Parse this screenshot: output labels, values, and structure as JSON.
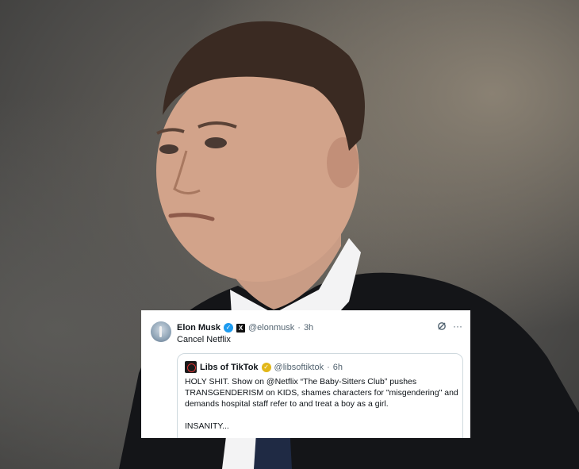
{
  "tweet": {
    "author_name": "Elon Musk",
    "handle": "@elonmusk",
    "separator": "·",
    "time": "3h",
    "text": "Cancel Netflix",
    "more_icon": "···"
  },
  "quoted_tweet": {
    "author_name": "Libs of TikTok",
    "handle": "@libsoftiktok",
    "separator": "·",
    "time": "6h",
    "body_line1": "HOLY SHIT. Show on @Netflix “The Baby-Sitters Club” pushes TRANSGENDERISM on KIDS, shames characters for \"misgendering\" and demands hospital staff refer to and treat a boy as a girl.",
    "body_line2": "INSANITY..."
  },
  "icons": {
    "verified_author": "blue-verified-check-icon",
    "x_affiliation": "x-logo-icon",
    "verified_quoted": "gold-verified-check-icon",
    "grok": "grok-icon",
    "more": "more-options-icon"
  },
  "colors": {
    "verified_blue": "#1d9bf0",
    "verified_gold": "#e2b719",
    "muted_text": "#536471"
  }
}
